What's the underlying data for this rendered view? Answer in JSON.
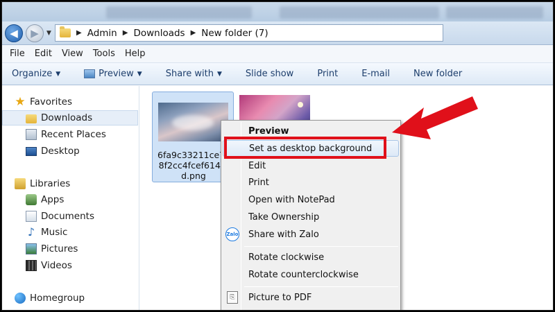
{
  "address": {
    "crumbs": [
      "Admin",
      "Downloads",
      "New folder (7)"
    ]
  },
  "menubar": {
    "items": [
      "File",
      "Edit",
      "View",
      "Tools",
      "Help"
    ]
  },
  "commandbar": {
    "organize": "Organize",
    "preview": "Preview",
    "share_with": "Share with",
    "slide_show": "Slide show",
    "print": "Print",
    "email": "E-mail",
    "new_folder": "New folder"
  },
  "sidebar": {
    "favorites": "Favorites",
    "downloads": "Downloads",
    "recent_places": "Recent Places",
    "desktop": "Desktop",
    "libraries": "Libraries",
    "apps": "Apps",
    "documents": "Documents",
    "music": "Music",
    "pictures": "Pictures",
    "videos": "Videos",
    "homegroup": "Homegroup"
  },
  "files": [
    {
      "name": "6fa9c33211ce7c\n8f2cc4fcef6144l\nd.png"
    }
  ],
  "context_menu": {
    "preview": "Preview",
    "set_background": "Set as desktop background",
    "edit": "Edit",
    "print": "Print",
    "open_notepad": "Open with NotePad",
    "take_ownership": "Take Ownership",
    "share_zalo": "Share with Zalo",
    "rotate_cw": "Rotate clockwise",
    "rotate_ccw": "Rotate counterclockwise",
    "picture_pdf": "Picture to PDF",
    "zalo_icon_text": "Zalo"
  },
  "colors": {
    "annotation_red": "#e0101a"
  }
}
